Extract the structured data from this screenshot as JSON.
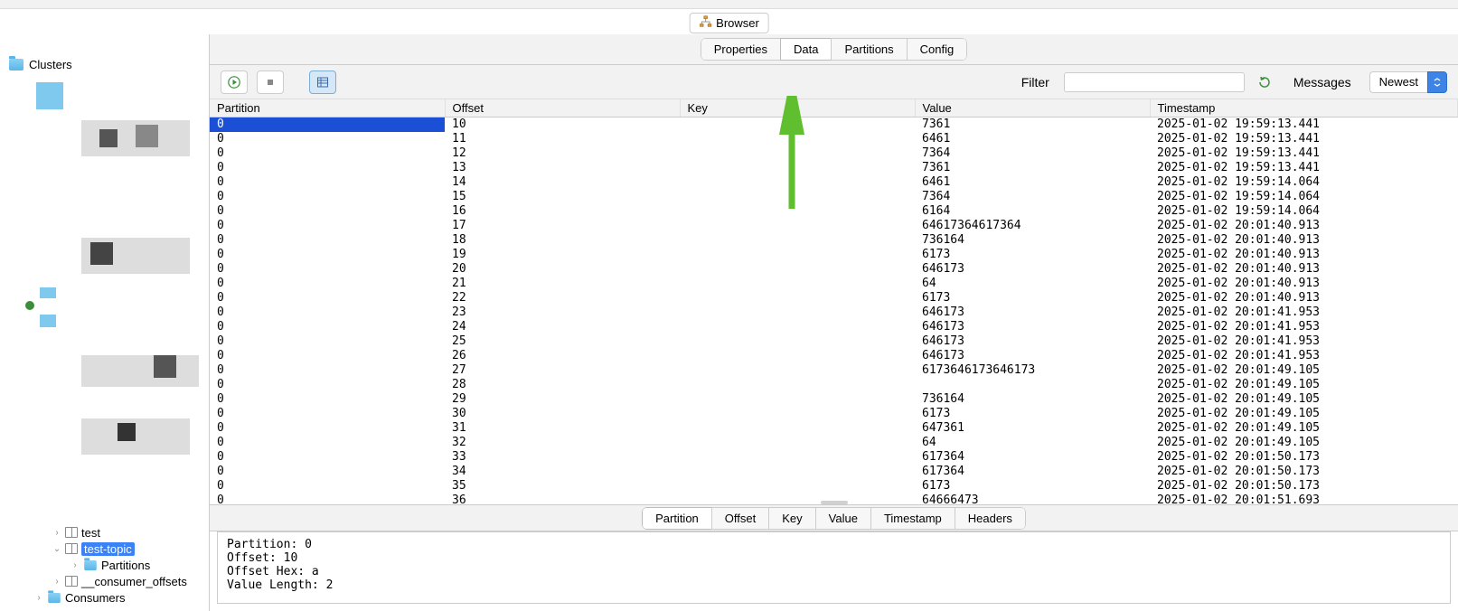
{
  "browser_pill": "Browser",
  "sidebar": {
    "root_label": "Clusters",
    "tree": {
      "test": "test",
      "test_topic": "test-topic",
      "partitions": "Partitions",
      "consumer_offsets": "__consumer_offsets",
      "consumers": "Consumers"
    }
  },
  "main_tabs": [
    "Properties",
    "Data",
    "Partitions",
    "Config"
  ],
  "active_main_tab": "Data",
  "toolbar": {
    "filter_label": "Filter",
    "messages_label": "Messages",
    "order_selected": "Newest"
  },
  "columns": [
    "Partition",
    "Offset",
    "Key",
    "Value",
    "Timestamp"
  ],
  "rows": [
    {
      "partition": "0",
      "offset": "10",
      "key": "",
      "value": "7361",
      "timestamp": "2025-01-02 19:59:13.441",
      "selected": true
    },
    {
      "partition": "0",
      "offset": "11",
      "key": "",
      "value": "6461",
      "timestamp": "2025-01-02 19:59:13.441"
    },
    {
      "partition": "0",
      "offset": "12",
      "key": "",
      "value": "7364",
      "timestamp": "2025-01-02 19:59:13.441"
    },
    {
      "partition": "0",
      "offset": "13",
      "key": "",
      "value": "7361",
      "timestamp": "2025-01-02 19:59:13.441"
    },
    {
      "partition": "0",
      "offset": "14",
      "key": "",
      "value": "6461",
      "timestamp": "2025-01-02 19:59:14.064"
    },
    {
      "partition": "0",
      "offset": "15",
      "key": "",
      "value": "7364",
      "timestamp": "2025-01-02 19:59:14.064"
    },
    {
      "partition": "0",
      "offset": "16",
      "key": "",
      "value": "6164",
      "timestamp": "2025-01-02 19:59:14.064"
    },
    {
      "partition": "0",
      "offset": "17",
      "key": "",
      "value": "64617364617364",
      "timestamp": "2025-01-02 20:01:40.913"
    },
    {
      "partition": "0",
      "offset": "18",
      "key": "",
      "value": "736164",
      "timestamp": "2025-01-02 20:01:40.913"
    },
    {
      "partition": "0",
      "offset": "19",
      "key": "",
      "value": "6173",
      "timestamp": "2025-01-02 20:01:40.913"
    },
    {
      "partition": "0",
      "offset": "20",
      "key": "",
      "value": "646173",
      "timestamp": "2025-01-02 20:01:40.913"
    },
    {
      "partition": "0",
      "offset": "21",
      "key": "",
      "value": "64",
      "timestamp": "2025-01-02 20:01:40.913"
    },
    {
      "partition": "0",
      "offset": "22",
      "key": "",
      "value": "6173",
      "timestamp": "2025-01-02 20:01:40.913"
    },
    {
      "partition": "0",
      "offset": "23",
      "key": "",
      "value": "646173",
      "timestamp": "2025-01-02 20:01:41.953"
    },
    {
      "partition": "0",
      "offset": "24",
      "key": "",
      "value": "646173",
      "timestamp": "2025-01-02 20:01:41.953"
    },
    {
      "partition": "0",
      "offset": "25",
      "key": "",
      "value": "646173",
      "timestamp": "2025-01-02 20:01:41.953"
    },
    {
      "partition": "0",
      "offset": "26",
      "key": "",
      "value": "646173",
      "timestamp": "2025-01-02 20:01:41.953"
    },
    {
      "partition": "0",
      "offset": "27",
      "key": "",
      "value": "6173646173646173",
      "timestamp": "2025-01-02 20:01:49.105"
    },
    {
      "partition": "0",
      "offset": "28",
      "key": "",
      "value": "",
      "timestamp": "2025-01-02 20:01:49.105"
    },
    {
      "partition": "0",
      "offset": "29",
      "key": "",
      "value": "736164",
      "timestamp": "2025-01-02 20:01:49.105"
    },
    {
      "partition": "0",
      "offset": "30",
      "key": "",
      "value": "6173",
      "timestamp": "2025-01-02 20:01:49.105"
    },
    {
      "partition": "0",
      "offset": "31",
      "key": "",
      "value": "647361",
      "timestamp": "2025-01-02 20:01:49.105"
    },
    {
      "partition": "0",
      "offset": "32",
      "key": "",
      "value": "64",
      "timestamp": "2025-01-02 20:01:49.105"
    },
    {
      "partition": "0",
      "offset": "33",
      "key": "",
      "value": "617364",
      "timestamp": "2025-01-02 20:01:50.173"
    },
    {
      "partition": "0",
      "offset": "34",
      "key": "",
      "value": "617364",
      "timestamp": "2025-01-02 20:01:50.173"
    },
    {
      "partition": "0",
      "offset": "35",
      "key": "",
      "value": "6173",
      "timestamp": "2025-01-02 20:01:50.173"
    },
    {
      "partition": "0",
      "offset": "36",
      "key": "",
      "value": "64666473",
      "timestamp": "2025-01-02 20:01:51.693"
    }
  ],
  "detail_tabs": [
    "Partition",
    "Offset",
    "Key",
    "Value",
    "Timestamp",
    "Headers"
  ],
  "active_detail_tab": "Partition",
  "detail_text": "Partition: 0\nOffset: 10\nOffset Hex: a\nValue Length: 2"
}
